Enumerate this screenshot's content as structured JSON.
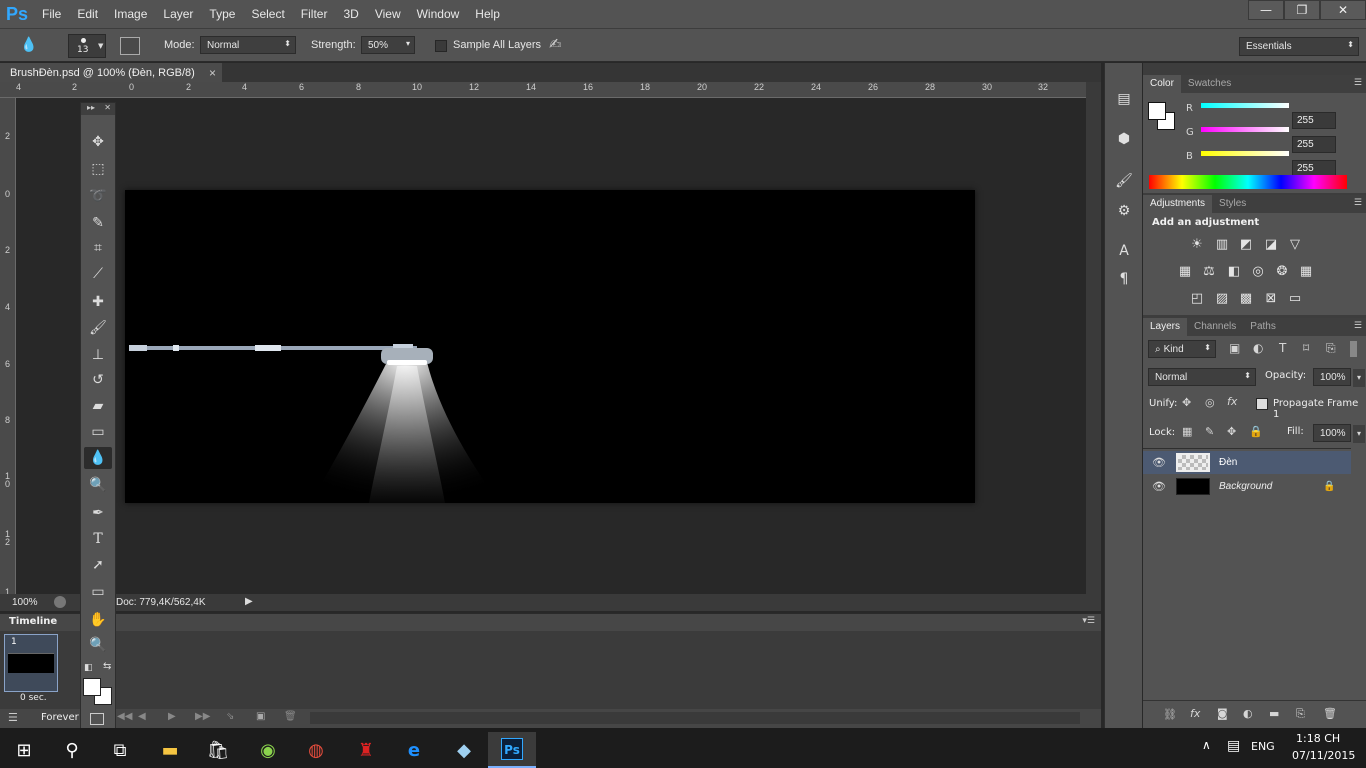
{
  "app": {
    "logo": "Ps",
    "menu": [
      "File",
      "Edit",
      "Image",
      "Layer",
      "Type",
      "Select",
      "Filter",
      "3D",
      "View",
      "Window",
      "Help"
    ],
    "window_controls": {
      "minimize": "—",
      "restore": "❐",
      "close": "✕"
    }
  },
  "options": {
    "brush_size": "13",
    "mode_label": "Mode:",
    "mode_value": "Normal",
    "strength_label": "Strength:",
    "strength_value": "50%",
    "sample_all_layers": "Sample All Layers",
    "workspace": "Essentials"
  },
  "document": {
    "tab_title": "BrushĐèn.psd @ 100% (Đèn, RGB/8)",
    "tab_close": "×",
    "zoom": "100%",
    "doc_info": "Doc: 779,4K/562,4K"
  },
  "rulers": {
    "top": [
      "4",
      "2",
      "0",
      "2",
      "4",
      "6",
      "8",
      "10",
      "12",
      "14",
      "16",
      "18",
      "20",
      "22",
      "24",
      "26",
      "28",
      "30",
      "32"
    ],
    "left": [
      "2",
      "0",
      "2",
      "4",
      "6",
      "8",
      "1\n0",
      "1\n2",
      "1"
    ]
  },
  "timeline": {
    "title": "Timeline",
    "frame_number": "1",
    "frame_delay": "0 sec.",
    "loop": "Forever"
  },
  "color_panel": {
    "tabs": [
      "Color",
      "Swatches"
    ],
    "r_label": "R",
    "g_label": "G",
    "b_label": "B",
    "r_value": "255",
    "g_value": "255",
    "b_value": "255"
  },
  "adjustments_panel": {
    "tabs": [
      "Adjustments",
      "Styles"
    ],
    "title": "Add an adjustment"
  },
  "layers_panel": {
    "tabs": [
      "Layers",
      "Channels",
      "Paths"
    ],
    "filter_kind": "Kind",
    "blend_mode": "Normal",
    "opacity_label": "Opacity:",
    "opacity_value": "100%",
    "unify_label": "Unify:",
    "propagate_label": "Propagate Frame 1",
    "lock_label": "Lock:",
    "fill_label": "Fill:",
    "fill_value": "100%",
    "layers": [
      {
        "name": "Đèn",
        "selected": true
      },
      {
        "name": "Background",
        "selected": false,
        "locked": true
      }
    ]
  },
  "taskbar": {
    "language": "ENG",
    "time": "1:18 CH",
    "date": "07/11/2015"
  },
  "colors": {
    "accent": "#31a8ff",
    "panel_bg": "#535353",
    "workspace_bg": "#282828",
    "canvas_bg": "#000000",
    "selected_layer": "#4c5a72"
  }
}
